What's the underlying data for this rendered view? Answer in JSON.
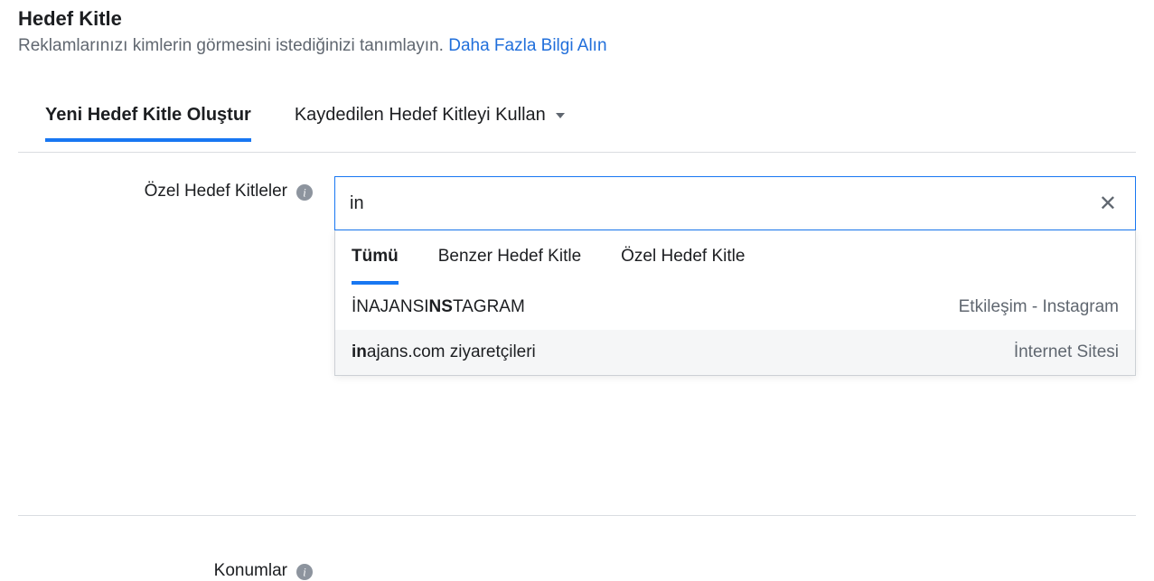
{
  "header": {
    "title": "Hedef Kitle",
    "subtitle_text": "Reklamlarınızı kimlerin görmesini istediğinizi tanımlayın. ",
    "learn_more": "Daha Fazla Bilgi Alın"
  },
  "tabs": {
    "create_new": "Yeni Hedef Kitle Oluştur",
    "use_saved": "Kaydedilen Hedef Kitleyi Kullan"
  },
  "custom_audiences": {
    "label": "Özel Hedef Kitleler",
    "search_value": "in",
    "dropdown_tabs": {
      "all": "Tümü",
      "lookalike": "Benzer Hedef Kitle",
      "custom": "Özel Hedef Kitle"
    },
    "results": [
      {
        "name_prefix": "İNAJANSI",
        "name_bold": "NS",
        "name_suffix": "TAGRAM",
        "type": "Etkileşim - Instagram"
      },
      {
        "name_prefix": "",
        "name_bold": "in",
        "name_suffix": "ajans.com ziyaretçileri",
        "type": "İnternet Sitesi"
      }
    ]
  },
  "locations": {
    "label": "Konumlar"
  }
}
